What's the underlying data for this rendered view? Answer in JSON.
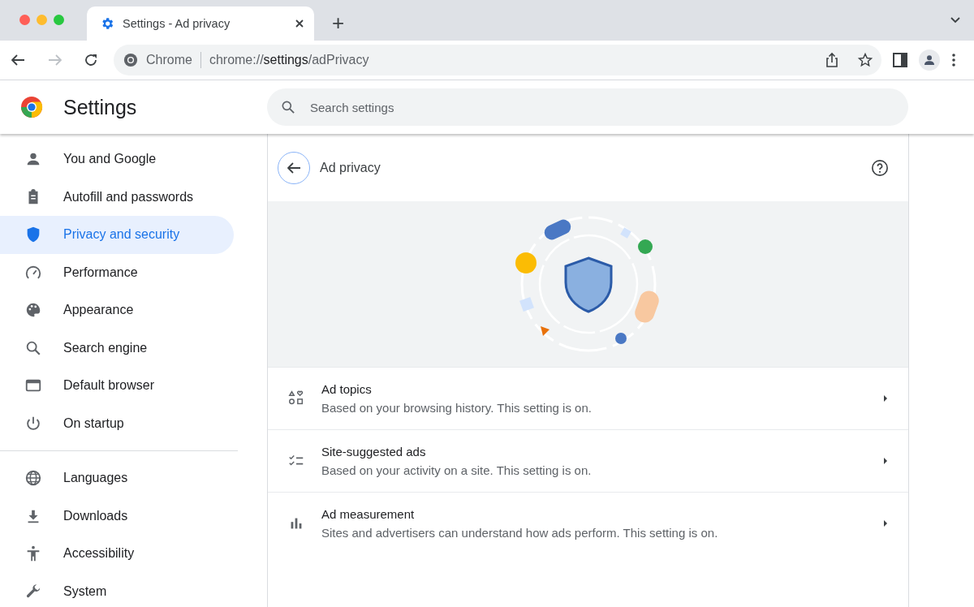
{
  "tab_strip": {
    "tabs": [
      {
        "title": "Settings - Ad privacy",
        "selected": true
      }
    ],
    "new_tab": "+"
  },
  "toolbar": {
    "omnibox": {
      "site_label": "Chrome",
      "url": "chrome://**settings**/adPrivacy"
    }
  },
  "header": {
    "title": "Settings",
    "search": {
      "placeholder": "Search settings"
    }
  },
  "sidebar": {
    "groups": [
      [
        {
          "label": "You and Google",
          "selected": false
        },
        {
          "label": "Autofill and passwords",
          "selected": false
        },
        {
          "label": "Privacy and security",
          "selected": true
        },
        {
          "label": "Performance",
          "selected": false
        },
        {
          "label": "Appearance",
          "selected": false
        },
        {
          "label": "Search engine",
          "selected": false
        },
        {
          "label": "Default browser",
          "selected": false
        },
        {
          "label": "On startup",
          "selected": false
        }
      ],
      [
        {
          "label": "Languages",
          "selected": false
        },
        {
          "label": "Downloads",
          "selected": false
        },
        {
          "label": "Accessibility",
          "selected": false
        },
        {
          "label": "System",
          "selected": false
        }
      ]
    ]
  },
  "page": {
    "title": "Ad privacy",
    "rows": [
      {
        "title": "Ad topics",
        "description": "Based on your browsing history. This setting is on."
      },
      {
        "title": "Site-suggested ads",
        "description": "Based on your activity on a site. This setting is on."
      },
      {
        "title": "Ad measurement",
        "description": "Sites and advertisers can understand how ads perform. This setting is on."
      }
    ]
  }
}
